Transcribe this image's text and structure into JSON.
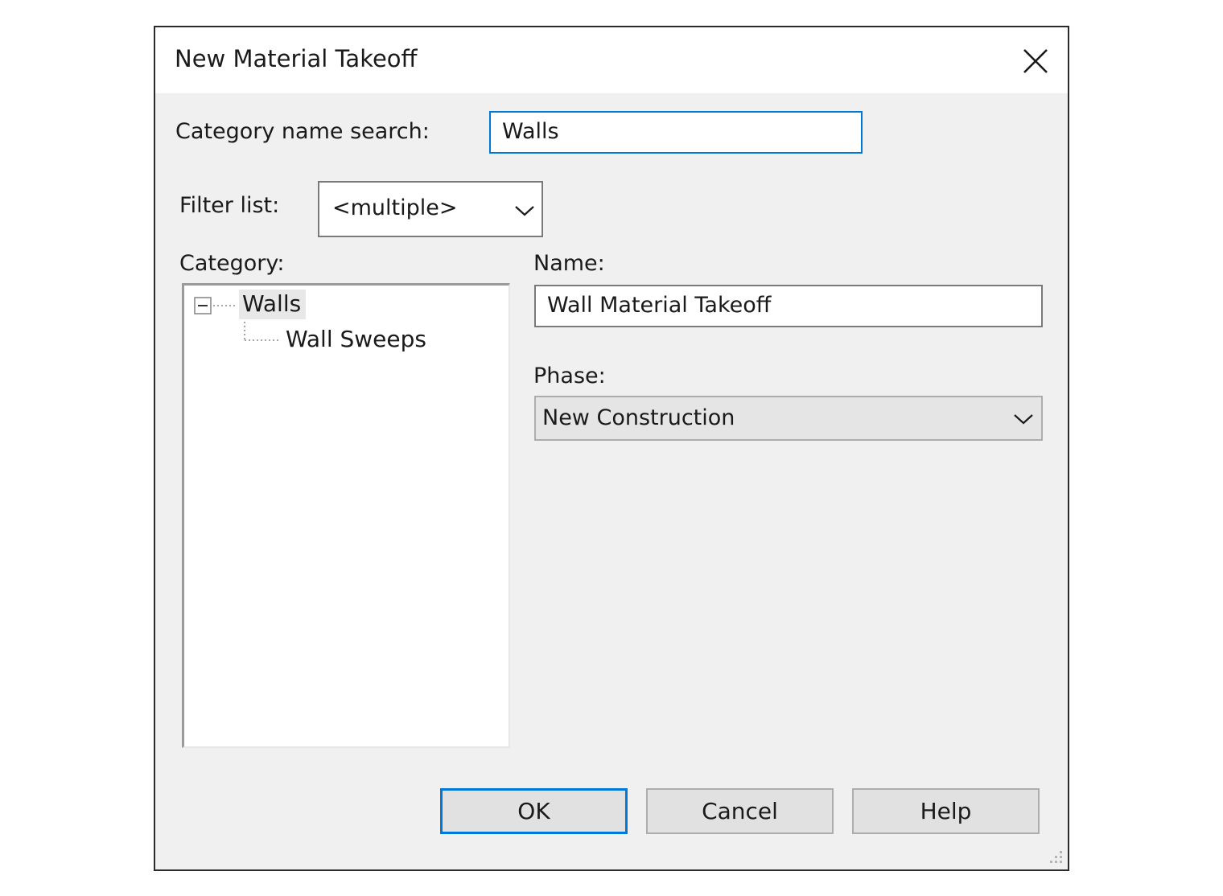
{
  "dialog": {
    "title": "New Material Takeoff",
    "close_icon": "close-icon"
  },
  "search": {
    "label": "Category name search:",
    "value": "Walls"
  },
  "filter": {
    "label": "Filter list:",
    "value": "<multiple>"
  },
  "category": {
    "label": "Category:",
    "tree": [
      {
        "label": "Walls",
        "expanded": true,
        "selected": true,
        "children": [
          {
            "label": "Wall Sweeps"
          }
        ]
      }
    ]
  },
  "name": {
    "label": "Name:",
    "value": "Wall Material Takeoff"
  },
  "phase": {
    "label": "Phase:",
    "value": "New Construction"
  },
  "buttons": {
    "ok": "OK",
    "cancel": "Cancel",
    "help": "Help"
  },
  "colors": {
    "focus_accent": "#0078d7",
    "dialog_background": "#f0f0f0",
    "button_face": "#e1e1e1"
  }
}
